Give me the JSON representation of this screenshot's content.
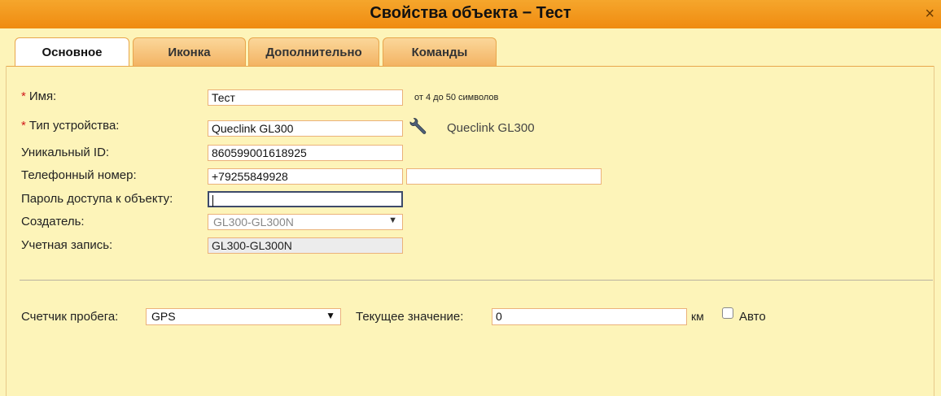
{
  "window": {
    "title": "Свойства объекта − Тест",
    "close_glyph": "×"
  },
  "tabs": [
    {
      "label": "Основное",
      "active": true
    },
    {
      "label": "Иконка",
      "active": false
    },
    {
      "label": "Дополнительно",
      "active": false
    },
    {
      "label": "Команды",
      "active": false
    }
  ],
  "form": {
    "required_mark": "*",
    "name": {
      "label": "Имя:",
      "value": "Тест",
      "hint": "от 4 до 50 символов"
    },
    "device_type": {
      "label": "Тип устройства:",
      "value": "Queclink GL300",
      "resolved": "Queclink GL300",
      "icon": "wrench-icon"
    },
    "unique_id": {
      "label": "Уникальный ID:",
      "value": "860599001618925"
    },
    "phone": {
      "label": "Телефонный номер:",
      "value": "+79255849928",
      "second_value": ""
    },
    "password": {
      "label": "Пароль доступа к объекту:",
      "value": ""
    },
    "creator": {
      "label": "Создатель:",
      "selected": "GL300-GL300N"
    },
    "account": {
      "label": "Учетная запись:",
      "value": "GL300-GL300N"
    }
  },
  "mileage": {
    "label": "Счетчик пробега:",
    "selected": "GPS",
    "current_label": "Текущее значение:",
    "current_value": "0",
    "unit": "км",
    "auto_label": "Авто",
    "auto_checked": false
  },
  "colors": {
    "background": "#fdf4b9",
    "titlebar": "#f29a1c",
    "field_border": "#ebb27a",
    "required": "#d0191b"
  }
}
